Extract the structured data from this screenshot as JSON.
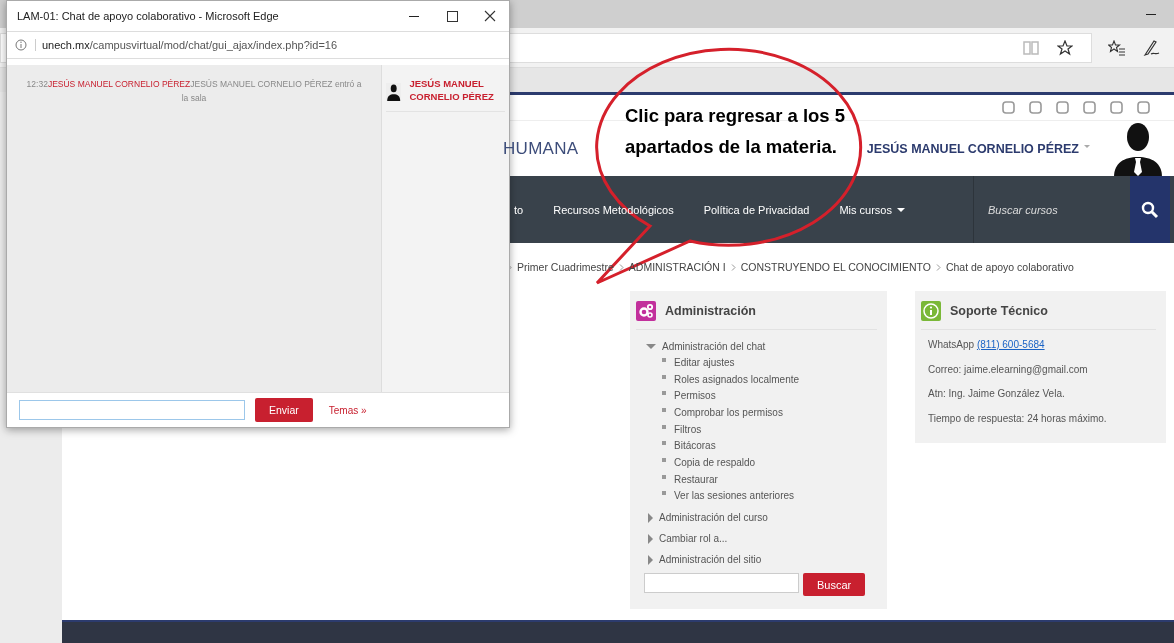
{
  "popup": {
    "title": "LAM-01: Chat de apoyo colaborativo - Microsoft Edge",
    "url_host": "unech.mx",
    "url_path": "/campusvirtual/mod/chat/gui_ajax/index.php?id=16",
    "messages": [
      {
        "time": "12:32",
        "user": "JESÚS MANUEL CORNELIO PÉREZ",
        "text": "JESÚS MANUEL CORNELIO PÉREZ entró a la sala"
      }
    ],
    "users": [
      {
        "name": "JESÚS MANUEL CORNELIO PÉREZ"
      }
    ],
    "send_button": "Enviar",
    "themes_link": "Temas »"
  },
  "site": {
    "header_title": "HUMANA",
    "user_name": "JESÚS MANUEL CORNELIO PÉREZ",
    "nav": [
      {
        "label": "to",
        "dropdown": false
      },
      {
        "label": "Recursos Metodológicos",
        "dropdown": false
      },
      {
        "label": "Política de Privacidad",
        "dropdown": false
      },
      {
        "label": "Mis cursos",
        "dropdown": true
      }
    ],
    "search": {
      "placeholder": "Buscar cursos"
    },
    "breadcrumb": [
      "Primer Cuadrimestre",
      "ADMINISTRACIÓN I",
      "CONSTRUYENDO EL CONOCIMIENTO",
      "Chat de apoyo colaborativo"
    ]
  },
  "callout": {
    "text": "Clic para regresar a los 5 apartados de la materia."
  },
  "admin_block": {
    "title": "Administración",
    "tree": [
      {
        "label": "Administración del chat",
        "expanded": true,
        "children": [
          {
            "label": "Editar ajustes"
          },
          {
            "label": "Roles asignados localmente"
          },
          {
            "label": "Permisos"
          },
          {
            "label": "Comprobar los permisos"
          },
          {
            "label": "Filtros"
          },
          {
            "label": "Bitácoras"
          },
          {
            "label": "Copia de respaldo"
          },
          {
            "label": "Restaurar"
          },
          {
            "label": "Ver las sesiones anteriores"
          }
        ]
      },
      {
        "label": "Administración del curso",
        "expanded": false
      },
      {
        "label": "Cambiar rol a...",
        "expanded": false
      },
      {
        "label": "Administración del sitio",
        "expanded": false
      }
    ],
    "search_button": "Buscar"
  },
  "support_block": {
    "title": "Soporte Técnico",
    "whatsapp": {
      "label": "WhatsApp",
      "link": "(811) 600-5684"
    },
    "lines": [
      "Correo: jaime.elearning@gmail.com",
      "Atn: Ing. Jaime González Vela.",
      "Tiempo de respuesta: 24 horas máximo."
    ]
  }
}
